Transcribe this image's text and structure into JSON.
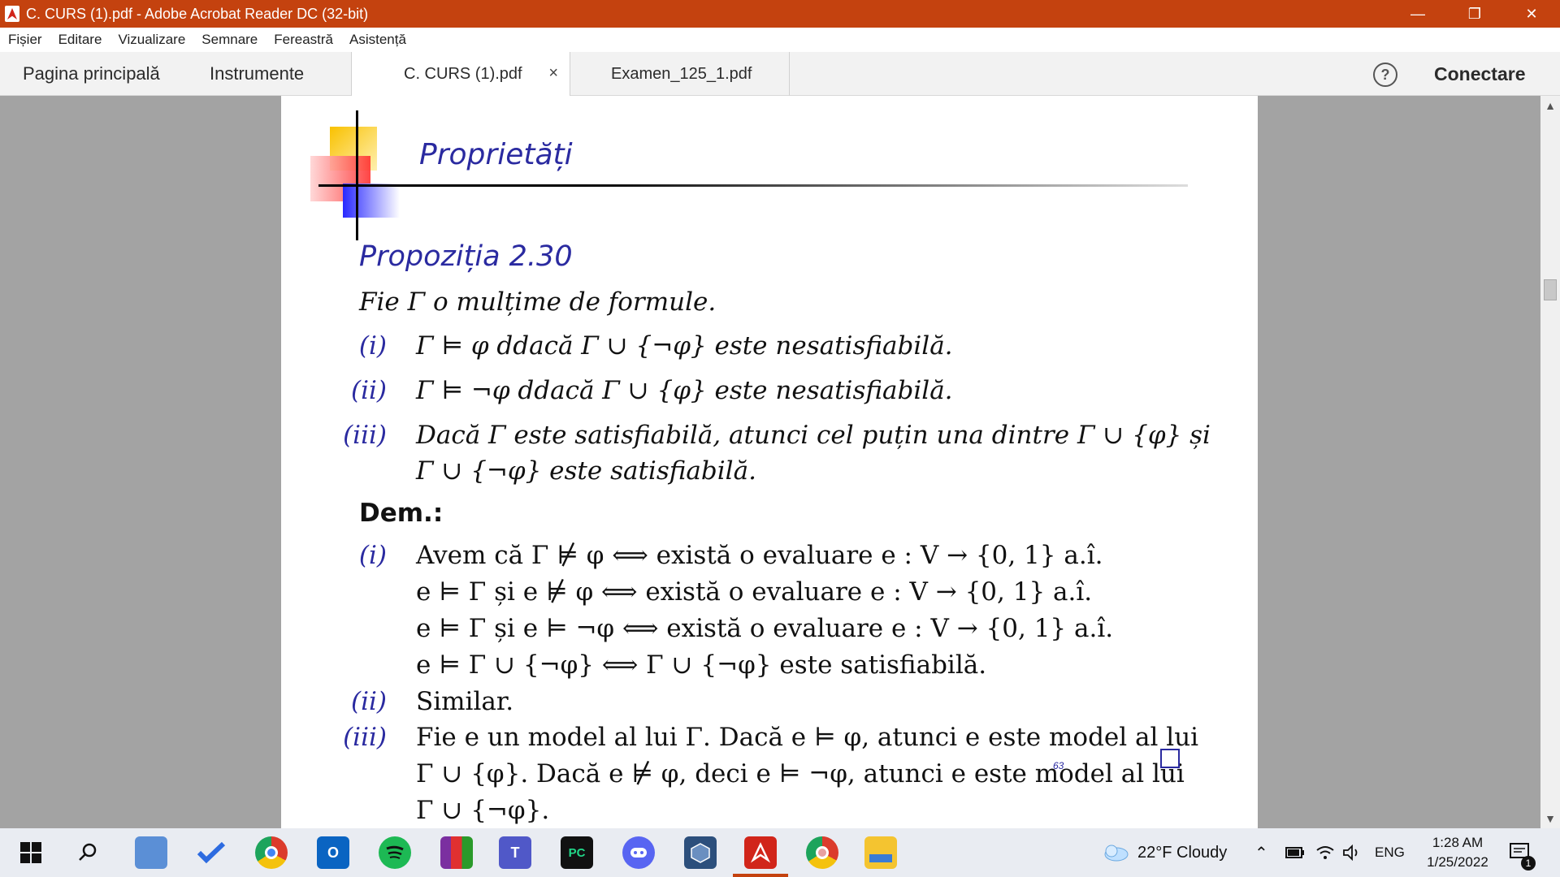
{
  "window": {
    "title": "C. CURS (1).pdf - Adobe Acrobat Reader DC (32-bit)",
    "minimize_glyph": "—",
    "restore_glyph": "❐",
    "close_glyph": "✕"
  },
  "menu": [
    "Fișier",
    "Editare",
    "Vizualizare",
    "Semnare",
    "Fereastră",
    "Asistență"
  ],
  "tabs": {
    "home": "Pagina principală",
    "tools": "Instrumente",
    "docs": [
      {
        "label": "C. CURS (1).pdf",
        "active": true,
        "close": "×"
      },
      {
        "label": "Examen_125_1.pdf",
        "active": false
      }
    ],
    "help": "?",
    "connect": "Conectare"
  },
  "slide": {
    "title": "Proprietăți",
    "proposition": "Propoziția 2.30",
    "intro": "Fie Γ o mulțime de formule.",
    "items": [
      {
        "num": "(i)",
        "text": "Γ ⊨ φ   ddacă Γ ∪ {¬φ} este nesatisfiabilă."
      },
      {
        "num": "(ii)",
        "text": "Γ ⊨ ¬φ   ddacă Γ ∪ {φ} este nesatisfiabilă."
      },
      {
        "num": "(iii)",
        "text": "Dacă Γ este satisfiabilă, atunci cel puțin una dintre Γ ∪ {φ} și",
        "cont": "Γ ∪ {¬φ} este satisfiabilă."
      }
    ],
    "dem_label": "Dem.:",
    "proof": [
      {
        "num": "(i)",
        "lines": [
          "Avem că Γ ⊭ φ  ⟺ există o evaluare e : V → {0, 1}  a.î.",
          "e ⊨ Γ și e ⊭ φ  ⟺ există o evaluare e : V → {0, 1}  a.î.",
          "e ⊨ Γ și e ⊨ ¬φ  ⟺ există o evaluare e : V → {0, 1}  a.î.",
          "e ⊨ Γ ∪ {¬φ}  ⟺ Γ ∪ {¬φ} este satisfiabilă."
        ]
      },
      {
        "num": "(ii)",
        "lines": [
          "Similar."
        ]
      },
      {
        "num": "(iii)",
        "lines": [
          "Fie e un model al lui Γ.  Dacă e ⊨ φ, atunci e este model al lui",
          "Γ ∪ {φ}.  Dacă e ⊭ φ, deci e ⊨ ¬φ, atunci e este model al lui",
          "Γ ∪ {¬φ}."
        ]
      }
    ],
    "page_number": "63"
  },
  "scrollbar": {
    "up": "▲",
    "down": "▼"
  },
  "taskbar": {
    "weather": "22°F  Cloudy",
    "lang": "ENG",
    "time": "1:28 AM",
    "date": "1/25/2022",
    "notifications": "1",
    "apps": [
      "start-icon",
      "search-icon",
      "desktop-icon",
      "todo-icon",
      "chrome-icon",
      "outlook-icon",
      "spotify-icon",
      "winrar-icon",
      "teams-icon",
      "pycharm-icon",
      "discord-icon",
      "virtualbox-icon",
      "acrobat-icon",
      "chrome-profile-icon",
      "explorer-icon"
    ]
  },
  "colors": {
    "titlebar": "#c4420f",
    "slide_blue": "#2a2aa0",
    "viewer_bg": "#a3a3a3"
  }
}
